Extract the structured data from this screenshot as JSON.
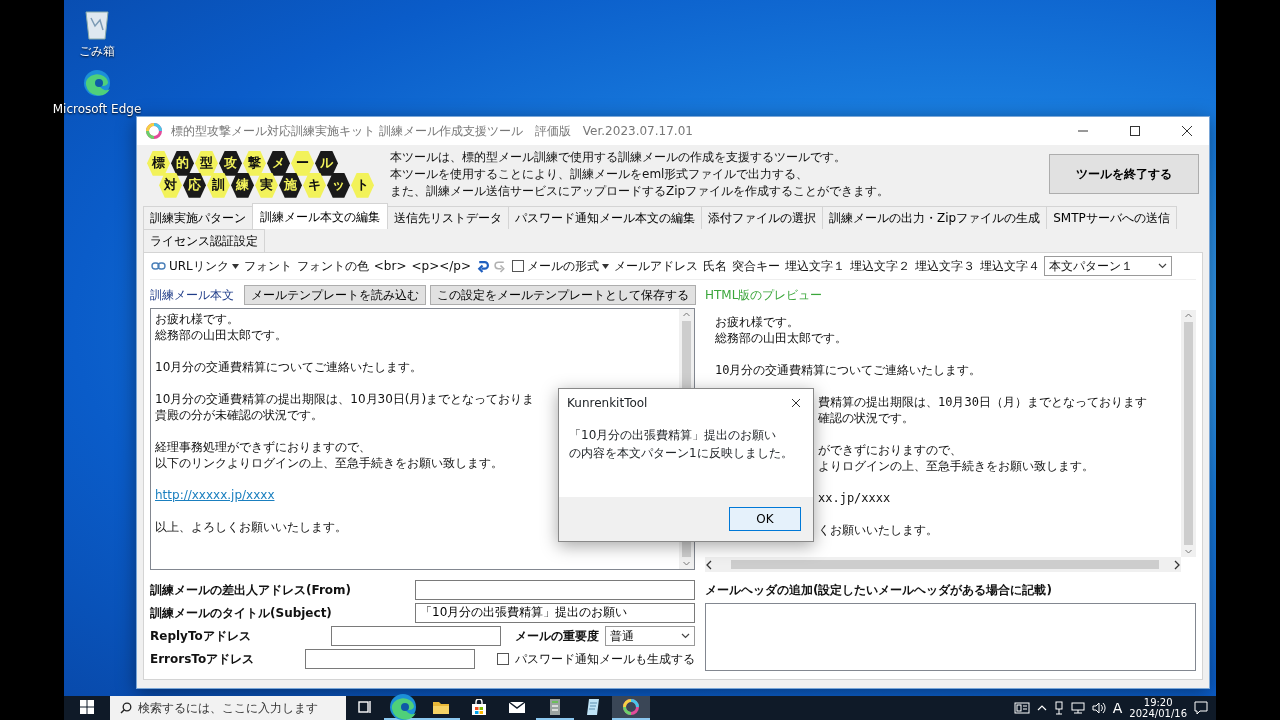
{
  "desktop_icons": [
    {
      "kind": "recycle",
      "label": "ごみ箱"
    },
    {
      "kind": "edge",
      "label": "Microsoft Edge"
    }
  ],
  "window": {
    "title": "標的型攻撃メール対応訓練実施キット 訓練メール作成支援ツール　評価版　Ver.2023.07.17.01",
    "logo_rows": [
      "標的型攻撃メール",
      "対応訓練実施キット"
    ],
    "description": [
      "本ツールは、標的型メール訓練で使用する訓練メールの作成を支援するツールです。",
      "本ツールを使用することにより、訓練メールをeml形式ファイルで出力する、",
      "また、訓練メール送信サービスにアップロードするZipファイルを作成することができます。"
    ],
    "exit_button": "ツールを終了する",
    "tabs": [
      {
        "label": "訓練実施パターン",
        "selected": false
      },
      {
        "label": "訓練メール本文の編集",
        "selected": true
      },
      {
        "label": "送信先リストデータ",
        "selected": false
      },
      {
        "label": "パスワード通知メール本文の編集",
        "selected": false
      },
      {
        "label": "添付ファイルの選択",
        "selected": false
      },
      {
        "label": "訓練メールの出力・Zipファイルの生成",
        "selected": false
      },
      {
        "label": "SMTPサーバへの送信",
        "selected": false
      },
      {
        "label": "ライセンス認証設定",
        "selected": false
      }
    ],
    "toolbar": [
      {
        "kind": "link_dropdown",
        "label": "URLリンク"
      },
      {
        "kind": "text",
        "label": "フォント"
      },
      {
        "kind": "text",
        "label": "フォントの色"
      },
      {
        "kind": "text",
        "label": "<br>"
      },
      {
        "kind": "text",
        "label": "<p></p>"
      },
      {
        "kind": "undo",
        "disabled": false
      },
      {
        "kind": "redo",
        "disabled": true
      },
      {
        "kind": "checkdrop",
        "label": "メールの形式",
        "checked": false
      },
      {
        "kind": "text",
        "label": "メールアドレス"
      },
      {
        "kind": "text",
        "label": "氏名"
      },
      {
        "kind": "text",
        "label": "突合キー"
      },
      {
        "kind": "text",
        "label": "埋込文字１"
      },
      {
        "kind": "text",
        "label": "埋込文字２"
      },
      {
        "kind": "text",
        "label": "埋込文字３"
      },
      {
        "kind": "text",
        "label": "埋込文字４"
      },
      {
        "kind": "select",
        "value": "本文パターン１"
      }
    ],
    "editor": {
      "label": "訓練メール本文",
      "load_button": "メールテンプレートを読み込む",
      "save_button": "この設定をメールテンプレートとして保存する",
      "lines": [
        {
          "kind": "text",
          "text": "お疲れ様です。"
        },
        {
          "kind": "text",
          "text": "総務部の山田太郎です。"
        },
        {
          "kind": "blank"
        },
        {
          "kind": "text",
          "text": "10月分の交通費精算についてご連絡いたします。"
        },
        {
          "kind": "blank"
        },
        {
          "kind": "text",
          "text": "10月分の交通費精算の提出期限は、10月30日(月)までとなっておりま"
        },
        {
          "kind": "text",
          "text": "貴殿の分が未確認の状況です。"
        },
        {
          "kind": "blank"
        },
        {
          "kind": "text",
          "text": "経理事務処理ができずにおりますので、"
        },
        {
          "kind": "text",
          "text": "以下のリンクよりログインの上、至急手続きをお願い致します。"
        },
        {
          "kind": "blank"
        },
        {
          "kind": "link",
          "text": "http://xxxxx.jp/xxxx"
        },
        {
          "kind": "blank"
        },
        {
          "kind": "text",
          "text": "以上、よろしくお願いいたします。"
        }
      ]
    },
    "preview": {
      "label": "HTML版のプレビュー",
      "lines": [
        {
          "kind": "full",
          "text": "お疲れ様です。"
        },
        {
          "kind": "full",
          "text": "総務部の山田太郎です。"
        },
        {
          "kind": "blank"
        },
        {
          "kind": "full",
          "text": "10月分の交通費精算についてご連絡いたします。"
        },
        {
          "kind": "blank"
        },
        {
          "kind": "partial",
          "text": "費精算の提出期限は、10月30日（月）までとなっております"
        },
        {
          "kind": "partial",
          "text": "確認の状況です。"
        },
        {
          "kind": "blank"
        },
        {
          "kind": "partial",
          "text": "ができずにおりますので、"
        },
        {
          "kind": "partial",
          "text": "よりログインの上、至急手続きをお願い致します。"
        },
        {
          "kind": "blank"
        },
        {
          "kind": "partial",
          "text": "xx.jp/xxxx"
        },
        {
          "kind": "blank"
        },
        {
          "kind": "partial",
          "text": "くお願いいたします。"
        }
      ]
    },
    "form": {
      "from": {
        "label": "訓練メールの差出人アドレス(From)"
      },
      "subject": {
        "label": "訓練メールのタイトル(Subject)",
        "value": "「10月分の出張費精算」提出のお願い"
      },
      "reply_to": {
        "label": "ReplyToアドレス"
      },
      "errors_to": {
        "label": "ErrorsToアドレス"
      },
      "importance": {
        "label": "メールの重要度",
        "value": "普通"
      },
      "password_mail": {
        "label": "パスワード通知メールも生成する",
        "checked": false
      },
      "header": {
        "label": "メールヘッダの追加(設定したいメールヘッダがある場合に記載)"
      }
    }
  },
  "dialog": {
    "title": "KunrenkitTool",
    "message": [
      "「10月分の出張費精算」提出のお願い",
      "の内容を本文パターン1に反映しました。"
    ],
    "ok_button": "OK"
  },
  "taskbar": {
    "search_placeholder": "検索するには、ここに入力します",
    "apps": [
      {
        "kind": "taskview",
        "running": false,
        "selected": false
      },
      {
        "kind": "edge",
        "running": true,
        "selected": false
      },
      {
        "kind": "folder",
        "running": true,
        "selected": false
      },
      {
        "kind": "store",
        "running": false,
        "selected": false
      },
      {
        "kind": "mail",
        "running": false,
        "selected": false
      },
      {
        "kind": "server",
        "running": true,
        "selected": false
      },
      {
        "kind": "notepad",
        "running": false,
        "selected": false
      },
      {
        "kind": "ring",
        "running": true,
        "selected": true
      }
    ],
    "ime": "A",
    "time": "19:20",
    "date": "2024/01/16"
  }
}
